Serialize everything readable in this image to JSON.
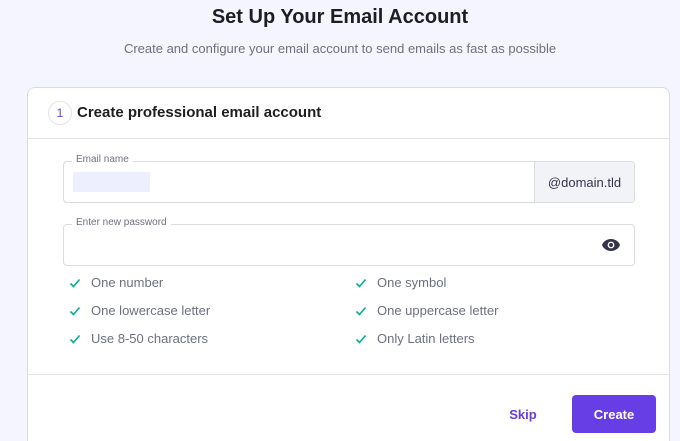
{
  "header": {
    "title": "Set Up Your Email Account",
    "subtitle": "Create and configure your email account to send emails as fast as possible"
  },
  "card": {
    "step_number": "1",
    "title": "Create professional email account",
    "email_field": {
      "label": "Email name",
      "domain_suffix": "@domain.tld"
    },
    "password_field": {
      "label": "Enter new password",
      "visibility_icon": "eye-icon"
    },
    "requirements": [
      {
        "label": "One number",
        "met": true
      },
      {
        "label": "One symbol",
        "met": true
      },
      {
        "label": "One lowercase letter",
        "met": true
      },
      {
        "label": "One uppercase letter",
        "met": true
      },
      {
        "label": "Use 8-50 characters",
        "met": true
      },
      {
        "label": "Only Latin letters",
        "met": true
      }
    ],
    "actions": {
      "skip_label": "Skip",
      "create_label": "Create"
    }
  },
  "colors": {
    "accent": "#673de6",
    "check": "#00b090",
    "background": "#f4f5ff"
  }
}
